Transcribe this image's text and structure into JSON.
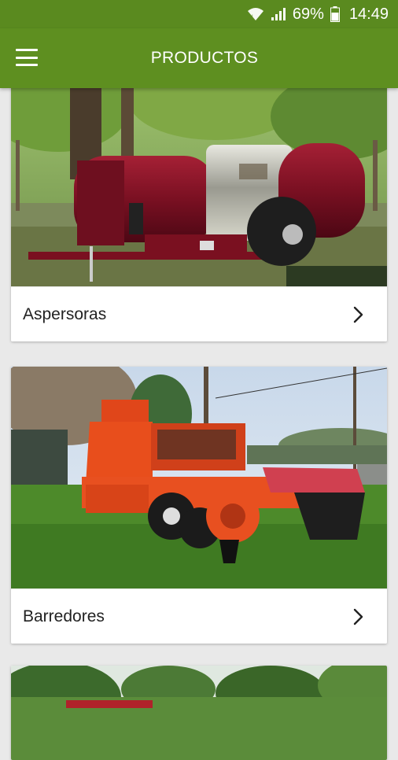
{
  "status_bar": {
    "wifi_icon": "wifi-icon",
    "signal_icon": "signal-icon",
    "battery_percent": "69%",
    "battery_icon": "battery-icon",
    "time": "14:49"
  },
  "app_bar": {
    "title": "PRODUCTOS",
    "menu_icon": "hamburger-menu-icon",
    "color": "#5e8f20"
  },
  "products": [
    {
      "label": "Aspersoras",
      "image": "red-orchard-sprayer-photo",
      "chevron_icon": "chevron-right-icon"
    },
    {
      "label": "Barredores",
      "image": "orange-harvester-sweeper-photo",
      "chevron_icon": "chevron-right-icon"
    },
    {
      "label": "",
      "image": "trees-field-photo",
      "chevron_icon": "chevron-right-icon"
    }
  ]
}
